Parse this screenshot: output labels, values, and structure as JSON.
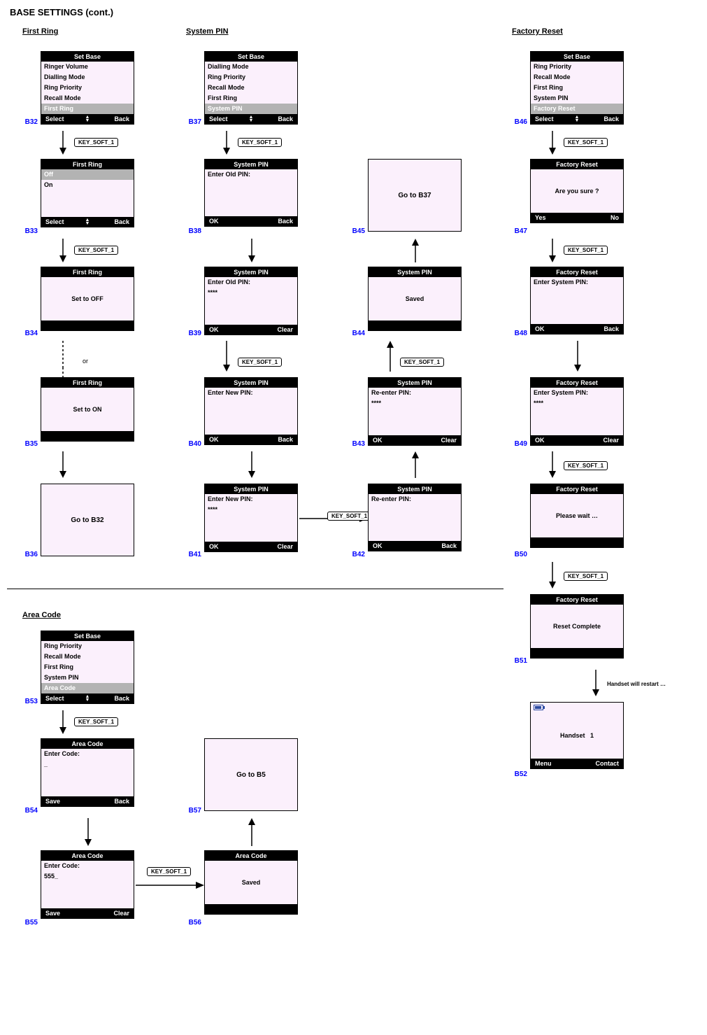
{
  "page_title": "BASE SETTINGS (cont.)",
  "sections": {
    "first_ring": "First Ring",
    "system_pin": "System PIN",
    "factory_reset": "Factory Reset",
    "area_code": "Area Code"
  },
  "glyph_updown": "▲\n▼",
  "key_soft_1": "KEY_SOFT_1",
  "or_label": "or",
  "handset_restart_note": "Handset will restart …",
  "screens": {
    "B32": {
      "title": "Set Base",
      "rows": [
        "Ringer Volume",
        "Dialling Mode",
        "Ring Priority",
        "Recall Mode"
      ],
      "selected": "First Ring",
      "soft_l": "Select",
      "soft_r": "Back",
      "mid": "updown"
    },
    "B33": {
      "title": "First Ring",
      "selected": "Off",
      "rows_after": [
        "On"
      ],
      "soft_l": "Select",
      "soft_r": "Back",
      "mid": "updown"
    },
    "B34": {
      "title": "First Ring",
      "body_center": "Set to OFF"
    },
    "B35": {
      "title": "First Ring",
      "body_center": "Set to ON"
    },
    "B36": {
      "goto": "Go to B32"
    },
    "B37": {
      "title": "Set Base",
      "rows": [
        "Dialling Mode",
        "Ring Priority",
        "Recall Mode",
        "First Ring"
      ],
      "selected": "System PIN",
      "soft_l": "Select",
      "soft_r": "Back",
      "mid": "updown"
    },
    "B38": {
      "title": "System PIN",
      "lines": [
        "Enter Old PIN:"
      ],
      "soft_l": "OK",
      "soft_r": "Back"
    },
    "B39": {
      "title": "System PIN",
      "lines": [
        "Enter Old PIN:",
        "****"
      ],
      "soft_l": "OK",
      "soft_r": "Clear"
    },
    "B40": {
      "title": "System PIN",
      "lines": [
        "Enter New PIN:"
      ],
      "soft_l": "OK",
      "soft_r": "Back"
    },
    "B41": {
      "title": "System PIN",
      "lines": [
        "Enter New PIN:",
        "****"
      ],
      "soft_l": "OK",
      "soft_r": "Clear"
    },
    "B42": {
      "title": "System PIN",
      "lines": [
        "Re-enter PIN:"
      ],
      "soft_l": "OK",
      "soft_r": "Back"
    },
    "B43": {
      "title": "System PIN",
      "lines": [
        "Re-enter PIN:",
        "****"
      ],
      "soft_l": "OK",
      "soft_r": "Clear"
    },
    "B44": {
      "title": "System PIN",
      "body_center": "Saved",
      "soft_l": "",
      "soft_r": ""
    },
    "B45": {
      "goto": "Go to B37"
    },
    "B46": {
      "title": "Set Base",
      "rows": [
        "Ring Priority",
        "Recall Mode",
        "First Ring",
        "System PIN"
      ],
      "selected": "Factory Reset",
      "soft_l": "Select",
      "soft_r": "Back",
      "mid": "updown"
    },
    "B47": {
      "title": "Factory Reset",
      "body_center": "Are you sure ?",
      "soft_l": "Yes",
      "soft_r": "No"
    },
    "B48": {
      "title": "Factory Reset",
      "lines": [
        "Enter System PIN:"
      ],
      "soft_l": "OK",
      "soft_r": "Back"
    },
    "B49": {
      "title": "Factory Reset",
      "lines": [
        "Enter System PIN:",
        "****"
      ],
      "soft_l": "OK",
      "soft_r": "Clear"
    },
    "B50": {
      "title": "Factory Reset",
      "body_center": "Please wait …",
      "soft_l": "",
      "soft_r": ""
    },
    "B51": {
      "title": "Factory Reset",
      "body_center": "Reset Complete",
      "soft_l": "",
      "soft_r": ""
    },
    "B52": {
      "handset_title": "Handset",
      "handset_num": "1",
      "soft_l": "Menu",
      "soft_r": "Contact"
    },
    "B53": {
      "title": "Set Base",
      "rows": [
        "Ring Priority",
        "Recall Mode",
        "First Ring",
        "System PIN"
      ],
      "selected": "Area Code",
      "soft_l": "Select",
      "soft_r": "Back",
      "mid": "updown"
    },
    "B54": {
      "title": "Area Code",
      "lines": [
        "Enter Code:",
        "_"
      ],
      "soft_l": "Save",
      "soft_r": "Back"
    },
    "B55": {
      "title": "Area Code",
      "lines": [
        "Enter Code:",
        "555_"
      ],
      "soft_l": "Save",
      "soft_r": "Clear"
    },
    "B56": {
      "title": "Area Code",
      "body_center": "Saved",
      "soft_l": "",
      "soft_r": ""
    },
    "B57": {
      "goto": "Go to B5"
    }
  }
}
